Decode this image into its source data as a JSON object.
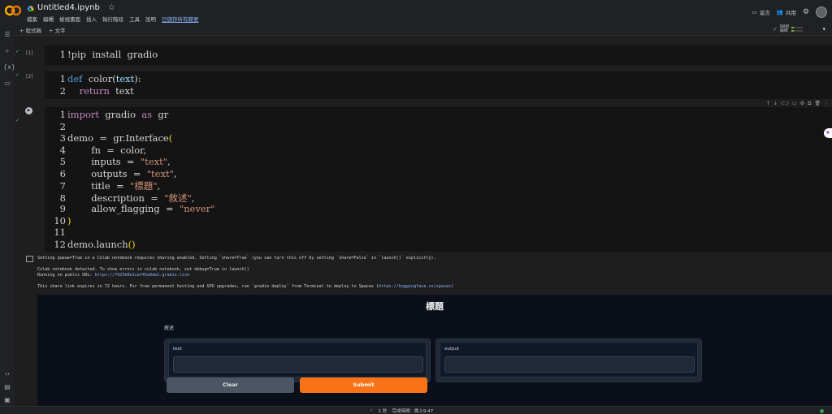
{
  "header": {
    "title": "Untitled4.ipynb",
    "menu": [
      "檔案",
      "編輯",
      "檢視畫面",
      "插入",
      "執行階段",
      "工具",
      "說明"
    ],
    "unsaved": "已儲存所有變更",
    "comment": "留言",
    "share": "共用"
  },
  "toolbar": {
    "add_code": "+ 程式碼",
    "add_text": "+ 文字",
    "ram": "RAM",
    "disk": "磁碟"
  },
  "cells": [
    {
      "count": "[1]",
      "lines": [
        "!pip  install  gradio"
      ]
    },
    {
      "count": "[2]",
      "lines": [
        "def  color(text):",
        "    return  text"
      ]
    },
    {
      "count": "",
      "lines": [
        "import  gradio  as  gr",
        "",
        "demo  =  gr.Interface(",
        "        fn  =  color,",
        "        inputs  =  \"text\",",
        "        outputs  =  \"text\",",
        "        title  =  \"標題\",",
        "        description  =  \"敘述\",",
        "        allow_flagging  =  \"never\"",
        ")",
        "",
        "demo.launch()"
      ]
    }
  ],
  "output": {
    "line1": "Setting queue=True in a Colab notebook requires sharing enabled. Setting `share=True` (you can turn this off by setting `share=False` in `launch()` explicitly).",
    "line2": "Colab notebook detected. To show errors in colab notebook, set debug=True in launch()",
    "line3_prefix": "Running on public URL: ",
    "line3_url": "https://f925b0e1caf45a0eb2.gradio.live",
    "line4_prefix": "This share link expires in 72 hours. For free permanent hosting and GPU upgrades, run `gradio deploy` from Terminal to deploy to Spaces (",
    "line4_url": "https://huggingface.co/spaces",
    "line4_suffix": ")"
  },
  "gradio": {
    "title": "標題",
    "description": "敘述",
    "input_label": "text",
    "output_label": "output",
    "clear": "Clear",
    "submit": "Submit"
  },
  "status": {
    "duration": "1 秒",
    "completed": "完成時間：晚上9:47"
  },
  "colors": {
    "accent_submit": "#f97316",
    "check_green": "#57bb8a"
  },
  "ram_usage": 0.2
}
